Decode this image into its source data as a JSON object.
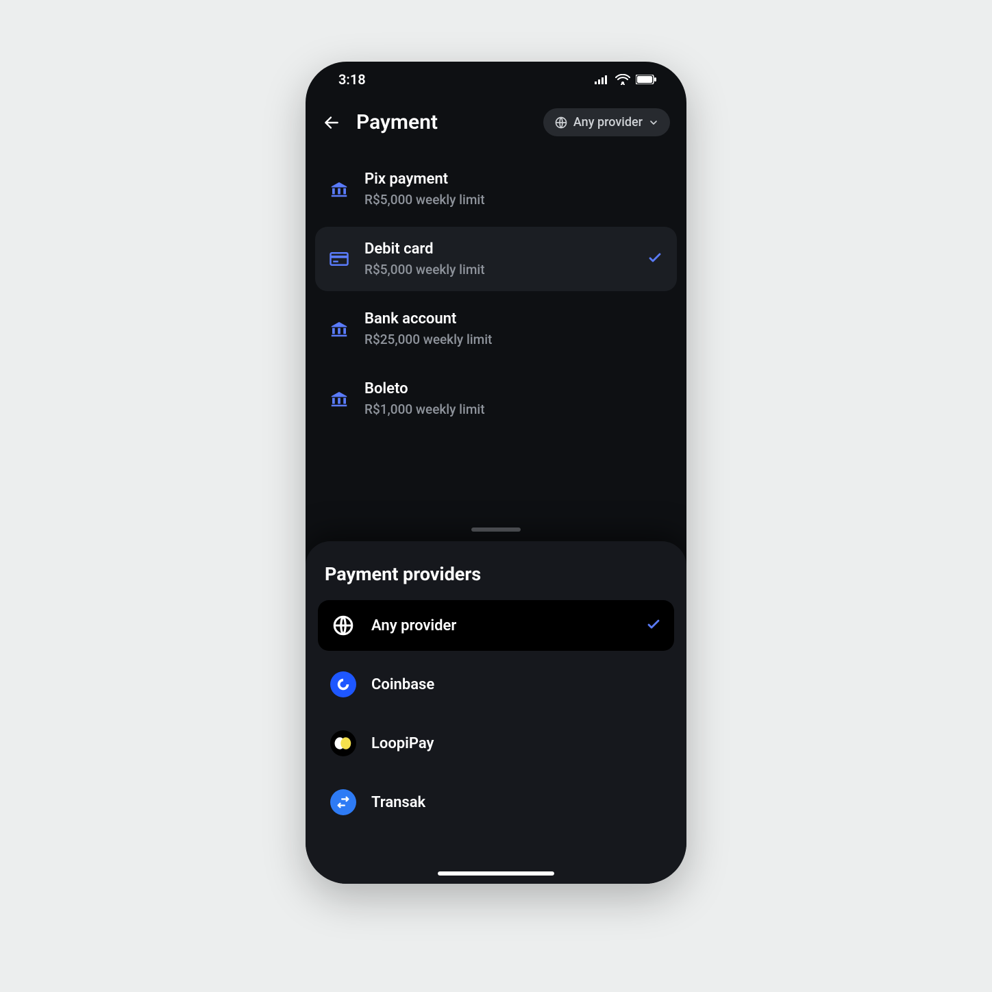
{
  "status": {
    "time": "3:18"
  },
  "header": {
    "title": "Payment",
    "filter": {
      "label": "Any provider"
    }
  },
  "methods": [
    {
      "icon": "bank",
      "label": "Pix payment",
      "sub": "R$5,000 weekly limit",
      "selected": false
    },
    {
      "icon": "card",
      "label": "Debit card",
      "sub": "R$5,000 weekly limit",
      "selected": true
    },
    {
      "icon": "bank",
      "label": "Bank account",
      "sub": "R$25,000 weekly limit",
      "selected": false
    },
    {
      "icon": "bank",
      "label": "Boleto",
      "sub": "R$1,000 weekly limit",
      "selected": false
    }
  ],
  "sheet": {
    "title": "Payment providers",
    "providers": [
      {
        "icon": "globe",
        "label": "Any provider",
        "selected": true
      },
      {
        "icon": "coinbase",
        "label": "Coinbase",
        "selected": false
      },
      {
        "icon": "loopipay",
        "label": "LoopiPay",
        "selected": false
      },
      {
        "icon": "transak",
        "label": "Transak",
        "selected": false
      }
    ]
  },
  "colors": {
    "accent": "#5a7bfa"
  }
}
